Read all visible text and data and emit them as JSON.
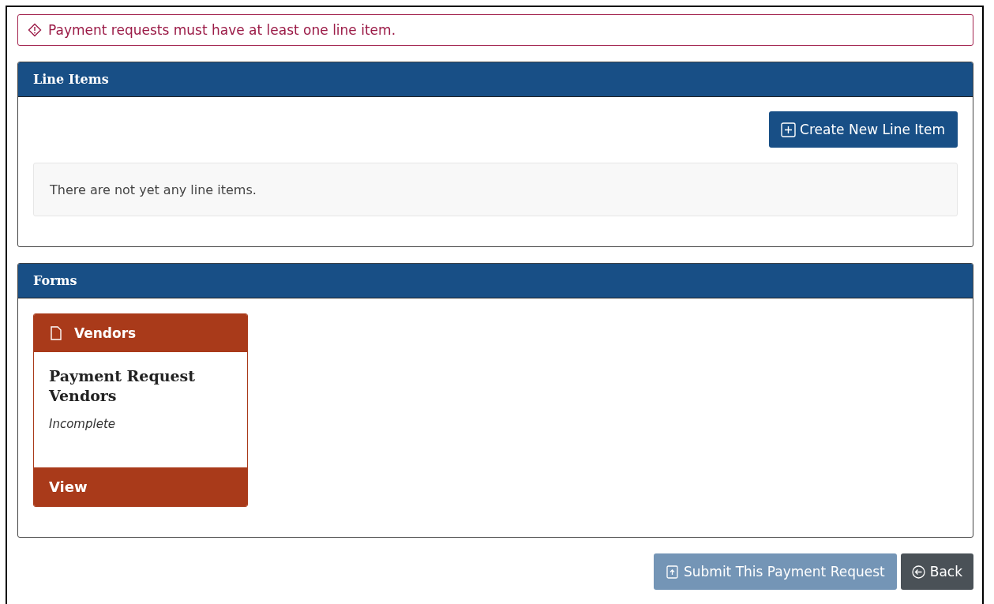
{
  "alert": {
    "message": "Payment requests must have at least one line item."
  },
  "line_items_panel": {
    "title": "Line Items",
    "create_button": "Create New Line Item",
    "empty_message": "There are not yet any line items."
  },
  "forms_panel": {
    "title": "Forms",
    "cards": [
      {
        "category": "Vendors",
        "title": "Payment Request Vendors",
        "status": "Incomplete",
        "action": "View"
      }
    ]
  },
  "actions": [
    {
      "kind": "submit",
      "label": "Submit This Payment Request",
      "disabled": true
    },
    {
      "kind": "back",
      "label": "Back",
      "disabled": false
    }
  ]
}
